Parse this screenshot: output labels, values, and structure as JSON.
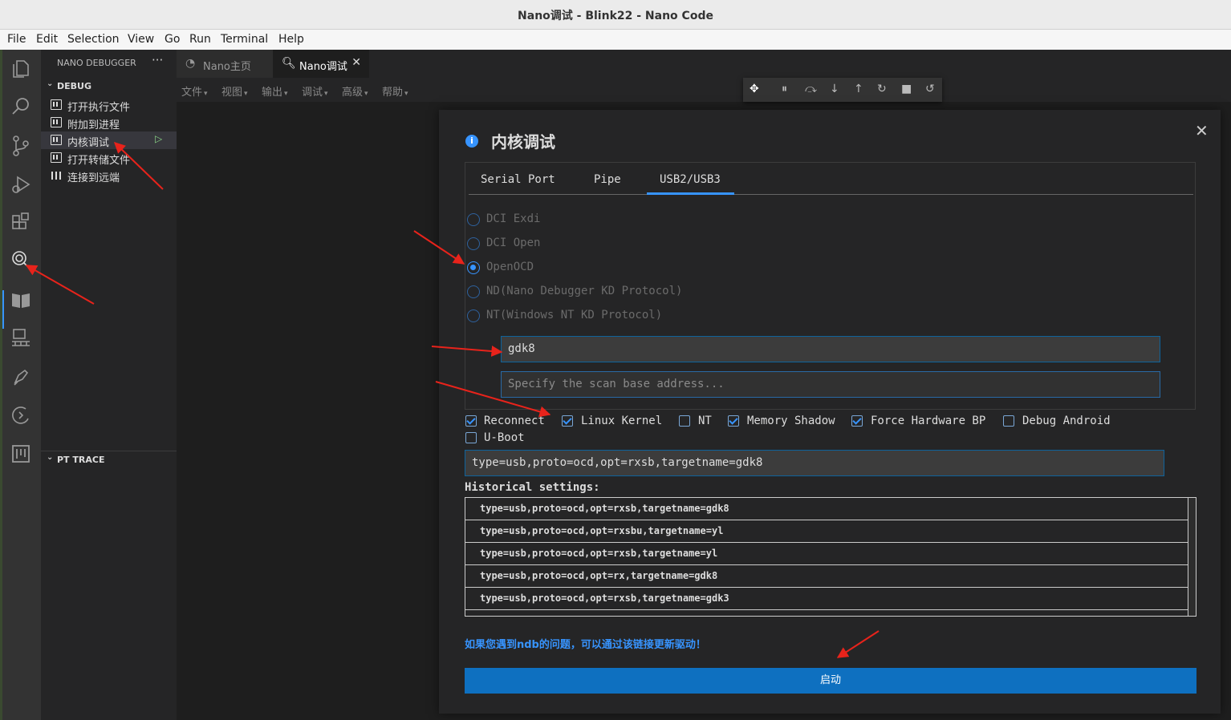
{
  "window": {
    "title": "Nano调试 - Blink22 - Nano Code",
    "close": "✕"
  },
  "menubar": [
    "File",
    "Edit",
    "Selection",
    "View",
    "Go",
    "Run",
    "Terminal",
    "Help"
  ],
  "sidebar": {
    "header": "NANO DEBUGGER",
    "more": "···",
    "debug_section": "DEBUG",
    "items": [
      {
        "label": "打开执行文件"
      },
      {
        "label": "附加到进程"
      },
      {
        "label": "内核调试"
      },
      {
        "label": "打开转储文件"
      },
      {
        "label": "连接到远端"
      }
    ],
    "pt_section": "PT TRACE"
  },
  "tabs": [
    {
      "label": "Nano主页"
    },
    {
      "label": "Nano调试",
      "close": "✕"
    }
  ],
  "editor_menu": [
    "文件",
    "视图",
    "输出",
    "调试",
    "高级",
    "帮助"
  ],
  "dialog": {
    "title": "内核调试",
    "info_icon": "i",
    "close": "✕",
    "tabs": [
      "Serial Port",
      "Pipe",
      "USB2/USB3"
    ],
    "active_tab": "USB2/USB3",
    "radios": [
      {
        "label": "DCI Exdi",
        "checked": false
      },
      {
        "label": "DCI Open",
        "checked": false
      },
      {
        "label": "OpenOCD",
        "checked": true
      },
      {
        "label": "ND(Nano Debugger KD Protocol)",
        "checked": false
      },
      {
        "label": "NT(Windows NT KD Protocol)",
        "checked": false
      }
    ],
    "target_value": "gdk8",
    "scan_placeholder": "Specify the scan base address...",
    "checkboxes": [
      {
        "label": "Reconnect",
        "checked": true
      },
      {
        "label": "Linux Kernel",
        "checked": true
      },
      {
        "label": "NT",
        "checked": false
      },
      {
        "label": "Memory Shadow",
        "checked": true
      },
      {
        "label": "Force Hardware BP",
        "checked": true
      },
      {
        "label": "Debug Android",
        "checked": false
      },
      {
        "label": "U-Boot",
        "checked": false
      }
    ],
    "command": "type=usb,proto=ocd,opt=rxsb,targetname=gdk8",
    "history_label": "Historical settings:",
    "history": [
      "type=usb,proto=ocd,opt=rxsb,targetname=gdk8",
      "type=usb,proto=ocd,opt=rxsbu,targetname=yl",
      "type=usb,proto=ocd,opt=rxsb,targetname=yl",
      "type=usb,proto=ocd,opt=rx,targetname=gdk8",
      "type=usb,proto=ocd,opt=rxsb,targetname=gdk3"
    ],
    "link": "如果您遇到ndb的问题，可以通过该链接更新驱动！",
    "start": "启动"
  },
  "colors": {
    "accent": "#3794ff",
    "button": "#0e70c0",
    "annotation_arrow": "#e8231b"
  }
}
